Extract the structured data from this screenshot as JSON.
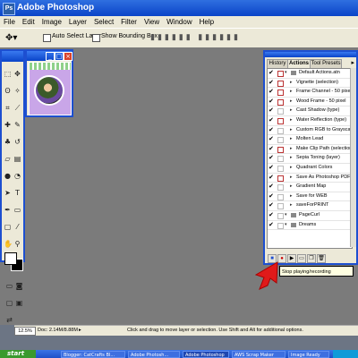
{
  "window": {
    "title": "Adobe Photoshop"
  },
  "menu": [
    "File",
    "Edit",
    "Image",
    "Layer",
    "Select",
    "Filter",
    "View",
    "Window",
    "Help"
  ],
  "options_bar": {
    "auto_select_layer": "Auto Select Layer",
    "show_bounding_box": "Show Bounding Box"
  },
  "palette": {
    "tabs": [
      "History",
      "Actions",
      "Tool Presets"
    ],
    "active_tab": "Actions",
    "items": [
      {
        "label": "Default Actions.atn",
        "kind": "set",
        "checked": true,
        "dialog": true
      },
      {
        "label": "Vignette (selection)",
        "kind": "action",
        "checked": true,
        "dialog": true
      },
      {
        "label": "Frame Channel - 50 pixel",
        "kind": "action",
        "checked": true,
        "dialog": true
      },
      {
        "label": "Wood Frame - 50 pixel",
        "kind": "action",
        "checked": true,
        "dialog": true
      },
      {
        "label": "Cast Shadow (type)",
        "kind": "action",
        "checked": true,
        "dialog": false
      },
      {
        "label": "Water Reflection (type)",
        "kind": "action",
        "checked": true,
        "dialog": true
      },
      {
        "label": "Custom RGB to Grayscale",
        "kind": "action",
        "checked": true,
        "dialog": false
      },
      {
        "label": "Molten Lead",
        "kind": "action",
        "checked": true,
        "dialog": false
      },
      {
        "label": "Make Clip Path (selection)",
        "kind": "action",
        "checked": true,
        "dialog": true
      },
      {
        "label": "Sepia Toning (layer)",
        "kind": "action",
        "checked": true,
        "dialog": false
      },
      {
        "label": "Quadrant Colors",
        "kind": "action",
        "checked": true,
        "dialog": false
      },
      {
        "label": "Save As Photoshop PDF",
        "kind": "action",
        "checked": true,
        "dialog": true
      },
      {
        "label": "Gradient Map",
        "kind": "action",
        "checked": true,
        "dialog": false
      },
      {
        "label": "Save for WEB",
        "kind": "action",
        "checked": true,
        "dialog": false
      },
      {
        "label": "saveForPRINT",
        "kind": "action",
        "checked": true,
        "dialog": false
      },
      {
        "label": "PageCurl",
        "kind": "set",
        "checked": true,
        "dialog": false
      },
      {
        "label": "Dreams",
        "kind": "set",
        "checked": true,
        "dialog": false
      }
    ]
  },
  "tooltip": "Stop playing/recording",
  "status": {
    "zoom": "12.5%",
    "doc": "Doc: 2.14M/8.88M",
    "hint": "Click and drag to move layer or selection. Use Shift and Alt for additional options."
  },
  "taskbar": {
    "start": "start",
    "items": [
      "Blogger: CatCrafts Bl...",
      "Adobe Photosh...",
      "Adobe Photoshop",
      "AWS Scrap Maker",
      "Image Ready"
    ]
  },
  "colors": {
    "accent": "#1d4fd0",
    "arrow": "#e01a1a"
  }
}
